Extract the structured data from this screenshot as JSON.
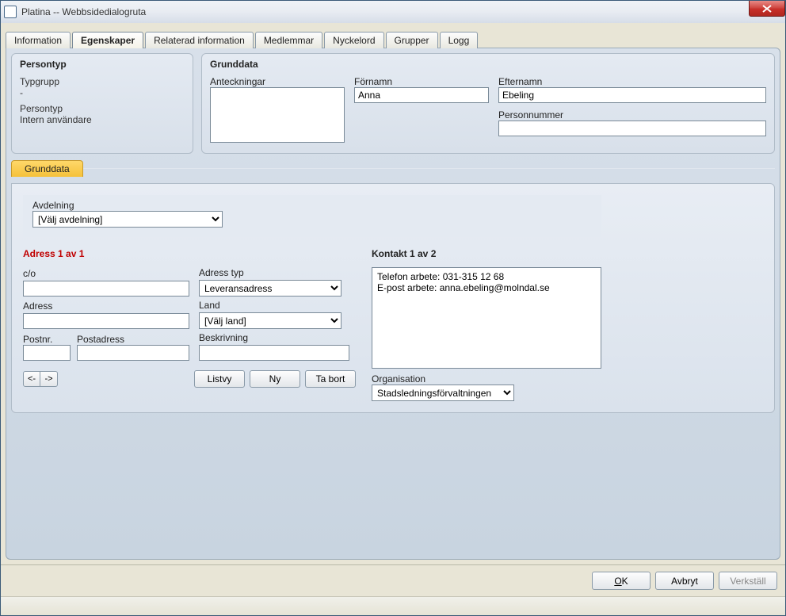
{
  "window": {
    "title": "Platina -- Webbsidedialogruta"
  },
  "tabs": [
    {
      "label": "Information"
    },
    {
      "label": "Egenskaper"
    },
    {
      "label": "Relaterad information"
    },
    {
      "label": "Medlemmar"
    },
    {
      "label": "Nyckelord"
    },
    {
      "label": "Grupper"
    },
    {
      "label": "Logg"
    }
  ],
  "active_tab": 1,
  "persontyp": {
    "header": "Persontyp",
    "typgrupp_label": "Typgrupp",
    "typgrupp_value": "-",
    "persontyp_label": "Persontyp",
    "persontyp_value": "Intern användare"
  },
  "grunddata_top": {
    "header": "Grunddata",
    "fornamn_label": "Förnamn",
    "fornamn_value": "Anna",
    "efternamn_label": "Efternamn",
    "efternamn_value": "Ebeling",
    "anteckningar_label": "Anteckningar",
    "anteckningar_value": "",
    "personnummer_label": "Personnummer",
    "personnummer_value": ""
  },
  "subtab": {
    "label": "Grunddata"
  },
  "avdelning": {
    "label": "Avdelning",
    "selected": "[Välj avdelning]"
  },
  "address": {
    "title": "Adress 1 av 1",
    "co_label": "c/o",
    "co_value": "",
    "adresstyp_label": "Adress typ",
    "adresstyp_value": "Leveransadress",
    "adress_label": "Adress",
    "adress_value": "",
    "land_label": "Land",
    "land_value": "[Välj land]",
    "postnr_label": "Postnr.",
    "postnr_value": "",
    "postadress_label": "Postadress",
    "postadress_value": "",
    "beskrivning_label": "Beskrivning",
    "beskrivning_value": "",
    "nav_prev": "<-",
    "nav_next": "->",
    "btn_list": "Listvy",
    "btn_new": "Ny",
    "btn_delete": "Ta bort"
  },
  "kontakt": {
    "title": "Kontakt 1 av 2",
    "lines": [
      "Telefon arbete: 031-315 12 68",
      "E-post arbete: anna.ebeling@molndal.se"
    ],
    "org_label": "Organisation",
    "org_value": "Stadsledningsförvaltningen"
  },
  "footer": {
    "ok": "OK",
    "ok_ul_index": 0,
    "cancel": "Avbryt",
    "apply": "Verkställ"
  }
}
